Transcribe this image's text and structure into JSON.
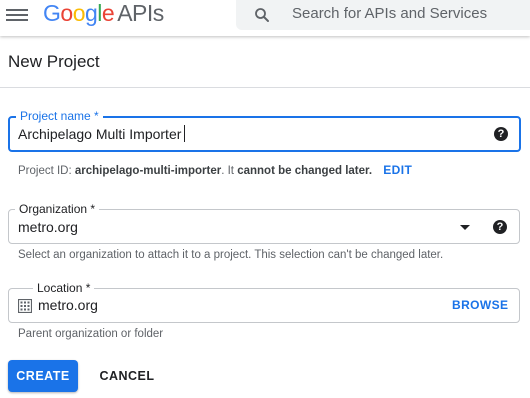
{
  "header": {
    "logo_google": [
      "G",
      "o",
      "o",
      "g",
      "l",
      "e"
    ],
    "logo_colors": [
      "#4285f4",
      "#ea4335",
      "#fbbc05",
      "#4285f4",
      "#34a853",
      "#ea4335"
    ],
    "logo_suffix": "APIs",
    "search_placeholder": "Search for APIs and Services"
  },
  "page": {
    "title": "New Project"
  },
  "form": {
    "project_name": {
      "label": "Project name *",
      "value": "Archipelago Multi Importer",
      "help_icon": "help-icon"
    },
    "project_id": {
      "prefix": "Project ID: ",
      "id": "archipelago-multi-importer",
      "middle": ". It ",
      "emphasis": "cannot be changed later.",
      "edit_label": "EDIT"
    },
    "organization": {
      "label": "Organization *",
      "value": "metro.org",
      "helper": "Select an organization to attach it to a project. This selection can't be changed later."
    },
    "location": {
      "label": "Location *",
      "value": "metro.org",
      "browse_label": "BROWSE",
      "helper": "Parent organization or folder"
    }
  },
  "actions": {
    "create_label": "CREATE",
    "cancel_label": "CANCEL"
  },
  "colors": {
    "accent": "#1a73e8"
  }
}
